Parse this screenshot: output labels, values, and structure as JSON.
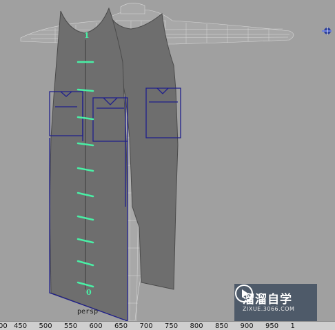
{
  "viewport": {
    "camera_label": "persp",
    "ruler_top_label": "1",
    "ruler_bottom_label": "0",
    "colors": {
      "background": "#a0a0a0",
      "mesh_wire": "#d8d8d8",
      "garment_fill": "#6e6e6e",
      "selection_outline": "#1a1a8a",
      "ruler": "#49f0a6"
    }
  },
  "watermark": {
    "main": "溜溜自学",
    "sub": "ZIXUE.3066.COM"
  },
  "timeline": {
    "ticks": [
      "00",
      "450",
      "500",
      "550",
      "600",
      "650",
      "700",
      "750",
      "800",
      "850",
      "900",
      "950",
      "1"
    ]
  }
}
